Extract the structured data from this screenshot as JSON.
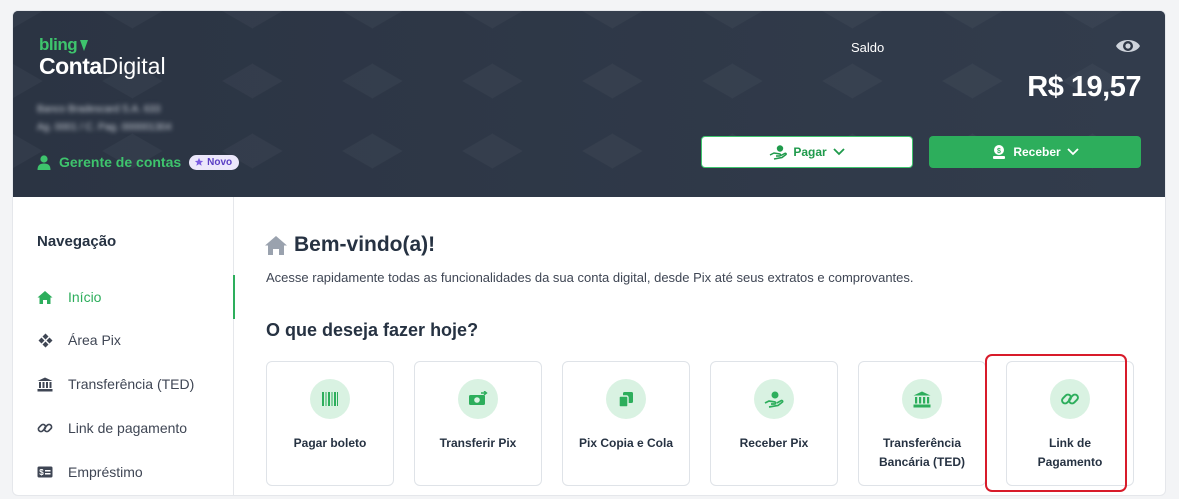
{
  "header": {
    "brand_small": "bling",
    "brand_bold": "Conta",
    "brand_light": "Digital",
    "bank_line1": "Banco Bradescard S.A. 633",
    "bank_line2": "Ag. 0001 / C. Pag. 000001304",
    "manager_label": "Gerente de contas",
    "badge_label": "Novo",
    "saldo_label": "Saldo",
    "balance": "R$ 19,57",
    "pay_button": "Pagar",
    "receive_button": "Receber"
  },
  "sidebar": {
    "title": "Navegação",
    "items": [
      {
        "label": "Início",
        "icon": "home-icon"
      },
      {
        "label": "Área Pix",
        "icon": "pix-icon"
      },
      {
        "label": "Transferência (TED)",
        "icon": "bank-icon"
      },
      {
        "label": "Link de pagamento",
        "icon": "link-icon"
      },
      {
        "label": "Empréstimo",
        "icon": "money-icon"
      }
    ]
  },
  "main": {
    "title": "Bem-vindo(a)!",
    "subtitle": "Acesse rapidamente todas as funcionalidades da sua conta digital, desde Pix até seus extratos e comprovantes.",
    "question": "O que deseja fazer hoje?",
    "cards": [
      {
        "label": "Pagar boleto",
        "icon": "barcode-icon"
      },
      {
        "label": "Transferir Pix",
        "icon": "transfer-money-icon"
      },
      {
        "label": "Pix Copia e Cola",
        "icon": "copy-icon"
      },
      {
        "label": "Receber Pix",
        "icon": "receive-hand-icon"
      },
      {
        "label": "Transferência Bancária (TED)",
        "icon": "bank-icon"
      },
      {
        "label": "Link de Pagamento",
        "icon": "link-icon"
      }
    ]
  },
  "colors": {
    "accent_green": "#2dae5c",
    "header_bg": "#2e3746",
    "highlight_red": "#d81b2a"
  }
}
